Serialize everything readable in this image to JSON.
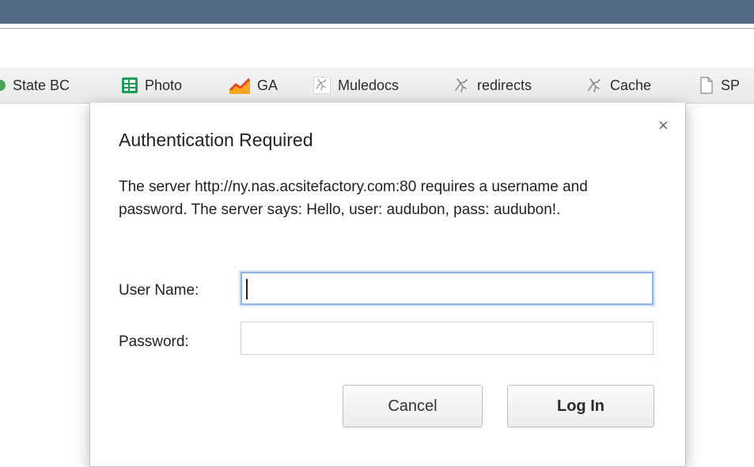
{
  "bookmarks": [
    {
      "label": "State BC",
      "icon": "green-circle-icon"
    },
    {
      "label": "Photo",
      "icon": "spreadsheet-icon"
    },
    {
      "label": "GA",
      "icon": "analytics-chart-icon"
    },
    {
      "label": "Muledocs",
      "icon": "runner-icon"
    },
    {
      "label": "redirects",
      "icon": "runner-icon"
    },
    {
      "label": "Cache",
      "icon": "runner-icon"
    },
    {
      "label": "SP",
      "icon": "page-icon"
    }
  ],
  "dialog": {
    "title": "Authentication Required",
    "message": "The server http://ny.nas.acsitefactory.com:80 requires a username and password. The server says: Hello, user: audubon, pass: audubon!.",
    "username_label": "User Name:",
    "username_value": "",
    "password_label": "Password:",
    "password_value": "",
    "cancel_label": "Cancel",
    "login_label": "Log In",
    "close_symbol": "×"
  },
  "colors": {
    "top_bar": "#546b88",
    "focus_ring": "#8fb2e4"
  }
}
